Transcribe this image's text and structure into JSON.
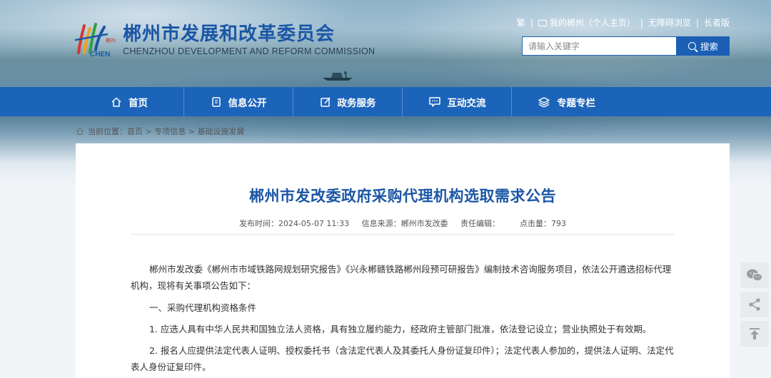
{
  "site": {
    "name_cn": "郴州市发展和改革委员会",
    "name_en": "CHENZHOU DEVELOPMENT AND REFORM COMMISSION",
    "logo_word": "CHEN",
    "logo_small": "郴州"
  },
  "toplinks": {
    "traditional": "繁",
    "my_chenzhou": "我的郴州（个人主页）",
    "accessible": "无障碍浏览",
    "elder": "长者版"
  },
  "search": {
    "placeholder": "请输入关键字",
    "button_label": "搜索"
  },
  "nav": {
    "items": [
      {
        "label": "首页",
        "icon": "home-icon"
      },
      {
        "label": "信息公开",
        "icon": "document-icon"
      },
      {
        "label": "政务服务",
        "icon": "edit-icon"
      },
      {
        "label": "互动交流",
        "icon": "chat-icon"
      },
      {
        "label": "专题专栏",
        "icon": "layers-icon"
      }
    ]
  },
  "breadcrumb": {
    "prefix": "当前位置：",
    "items": [
      "首页",
      "专项信息",
      "基础设施发展"
    ],
    "separator": " > "
  },
  "article": {
    "title": "郴州市发改委政府采购代理机构选取需求公告",
    "meta": "发布时间：2024-05-07 11:33     信息来源：郴州市发改委     责任编辑：        点击量：793",
    "paragraphs": [
      "郴州市发改委《郴州市市域铁路网规划研究报告》《兴永郴赣铁路郴州段预可研报告》编制技术咨询服务项目，依法公开遴选招标代理机构，现将有关事项公告如下：",
      "一、采购代理机构资格条件",
      "1. 应选人具有中华人民共和国独立法人资格，具有独立履约能力，经政府主管部门批准，依法登记设立；营业执照处于有效期。",
      "2. 报名人应提供法定代表人证明、授权委托书（含法定代表人及其委托人身份证复印件）；法定代表人参加的，提供法人证明、法定代表人身份证复印件。"
    ]
  },
  "side_tools": [
    "wechat-icon",
    "share-icon",
    "back-to-top-icon"
  ],
  "colors": {
    "brand_blue": "#1c64b9",
    "title_blue": "#1b56a5"
  }
}
